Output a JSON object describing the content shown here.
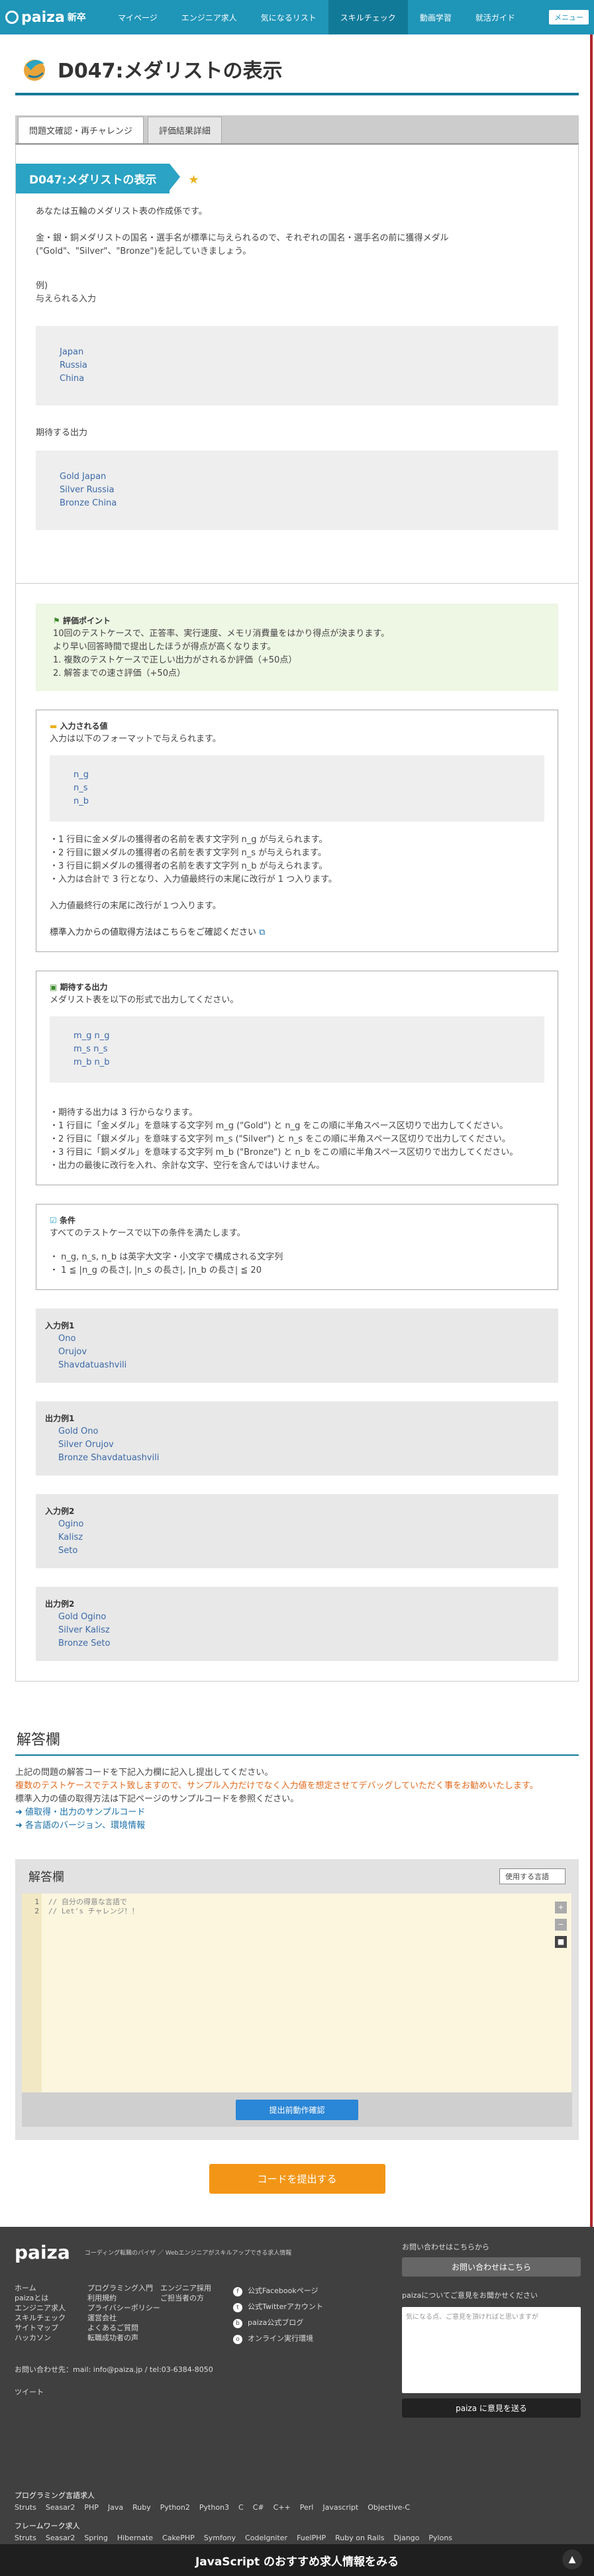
{
  "nav": {
    "logo": "paiza",
    "logo_suffix": "新卒",
    "items": [
      "マイページ",
      "エンジニア求人",
      "気になるリスト",
      "スキルチェック",
      "動画学習",
      "就活ガイド"
    ],
    "active_index": 3,
    "menu_label": "メニュー"
  },
  "page": {
    "title": "D047:メダリストの表示",
    "tabs": [
      "問題文確認・再チャレンジ",
      "評価結果詳細"
    ]
  },
  "problem": {
    "label": "D047:メダリストの表示",
    "p1": "あなたは五輪のメダリスト表の作成係です。",
    "p2": "金・銀・銅メダリストの国名・選手名が標準に与えられるので、それぞれの国名・選手名の前に獲得メダル (\"Gold\"、\"Silver\"、\"Bronze\")を記していきましょう。",
    "p3a": "例)",
    "p3b": "与えられる入力",
    "input_lines": [
      "Japan",
      "Russia",
      "China"
    ],
    "p4": "期待する出力",
    "output_lines": [
      "Gold Japan",
      "Silver Russia",
      "Bronze China"
    ]
  },
  "scoring": {
    "title": "評価ポイント",
    "lines": [
      "10回のテストケースで、正答率、実行速度、メモリ消費量をはかり得点が決まります。",
      "より早い回答時間で提出したほうが得点が高くなります。",
      "1. 複数のテストケースで正しい出力がされるか評価（+50点）",
      "2. 解答までの速さ評価（+50点）"
    ]
  },
  "input_spec": {
    "title": "入力される値",
    "intro": "入力は以下のフォーマットで与えられます。",
    "code": [
      "n_g",
      "n_s",
      "n_b"
    ],
    "bullets": [
      "・1 行目に金メダルの獲得者の名前を表す文字列 n_g が与えられます。",
      "・2 行目に銀メダルの獲得者の名前を表す文字列 n_s が与えられます。",
      "・3 行目に銅メダルの獲得者の名前を表す文字列 n_b が与えられます。",
      "・入力は合計で 3 行となり、入力値最終行の末尾に改行が 1 つ入ります。"
    ],
    "note": "入力値最終行の末尾に改行が１つ入ります。",
    "link": "標準入力からの値取得方法はこちらをご確認ください"
  },
  "output_spec": {
    "title": "期待する出力",
    "intro": "メダリスト表を以下の形式で出力してください。",
    "code": [
      "m_g n_g",
      "m_s n_s",
      "m_b n_b"
    ],
    "bullets": [
      "・期待する出力は 3 行からなります。",
      "・1 行目に「金メダル」を意味する文字列 m_g (\"Gold\") と n_g をこの順に半角スペース区切りで出力してください。",
      "・2 行目に「銀メダル」を意味する文字列 m_s (\"Silver\") と n_s をこの順に半角スペース区切りで出力してください。",
      "・3 行目に「銅メダル」を意味する文字列 m_b (\"Bronze\") と n_b をこの順に半角スペース区切りで出力してください。",
      "・出力の最後に改行を入れ、余計な文字、空行を含んではいけません。"
    ]
  },
  "conditions": {
    "title": "条件",
    "intro": "すべてのテストケースで以下の条件を満たします。",
    "bullets": [
      "・ n_g, n_s, n_b は英字大文字・小文字で構成される文字列",
      "・ 1 ≦ |n_g の長さ|, |n_s の長さ|, |n_b の長さ| ≦ 20"
    ]
  },
  "examples": [
    {
      "title": "入力例1",
      "lines": [
        "Ono",
        "Orujov",
        "Shavdatuashvili"
      ]
    },
    {
      "title": "出力例1",
      "lines": [
        "Gold Ono",
        "Silver Orujov",
        "Bronze Shavdatuashvili"
      ]
    },
    {
      "title": "入力例2",
      "lines": [
        "Ogino",
        "Kalisz",
        "Seto"
      ]
    },
    {
      "title": "出力例2",
      "lines": [
        "Gold Ogino",
        "Silver Kalisz",
        "Bronze Seto"
      ]
    }
  ],
  "answer": {
    "heading": "解答欄",
    "note1": "上記の問題の解答コードを下記入力欄に記入し提出してください。",
    "note2": "複数のテストケースでテスト致しますので、サンプル入力だけでなく入力値を想定させてデバッグしていただく事をお勧めいたします。",
    "note3": "標準入力の値の取得方法は下記ページのサンプルコードを参照ください。",
    "link1": "値取得・出力のサンプルコード",
    "link2": "各言語のバージョン、環境情報",
    "panel_title": "解答欄",
    "lang_select": "使用する言語",
    "code_lines": [
      "// 自分の得意な言語で",
      "// Let's チャレンジ！！"
    ],
    "run_label": "提出前動作確認",
    "submit_label": "コードを提出する"
  },
  "footer": {
    "logo": "paiza",
    "tagline": "コーディング転職のパイザ ／ Webエンジニアがスキルアップできる求人情報",
    "col1": [
      "ホーム",
      "paizaとは",
      "エンジニア求人",
      "スキルチェック",
      "サイトマップ",
      "ハッカソン"
    ],
    "col2": [
      "プログラミング入門",
      "利用規約",
      "プライバシーポリシー",
      "運営会社",
      "よくあるご質問",
      "転職成功者の声"
    ],
    "col3": [
      "エンジニア採用",
      "ご担当者の方"
    ],
    "social": [
      "公式Facebookページ",
      "公式Twitterアカウント",
      "paiza公式ブログ",
      "オンライン実行環境"
    ],
    "contact_label": "お問い合わせはこちらから",
    "contact_btn": "お問い合わせはこちら",
    "opinion_label": "paizaについてご意見をお聞かせください",
    "opinion_placeholder": "気になる点、ご意見を頂ければと思いますが",
    "opinion_btn": "paiza に意見を送る",
    "contact_line": "お問い合わせ先：mail: info@paiza.jp / tel:03-6384-8050",
    "tweet": "ツイート",
    "lang_title": "プログラミング言語求人",
    "langs": [
      "Struts",
      "Seasar2",
      "PHP",
      "Java",
      "Ruby",
      "Python2",
      "Python3",
      "C",
      "C#",
      "C++",
      "Perl",
      "Javascript",
      "Objective-C"
    ],
    "fw_title": "フレームワーク求人",
    "fws": [
      "Struts",
      "Seasar2",
      "Spring",
      "Hibernate",
      "CakePHP",
      "Symfony",
      "CodeIgniter",
      "FuelPHP",
      "Ruby on Rails",
      "Django",
      "Pylons"
    ],
    "banner": "JavaScript のおすすめ求人情報をみる"
  }
}
